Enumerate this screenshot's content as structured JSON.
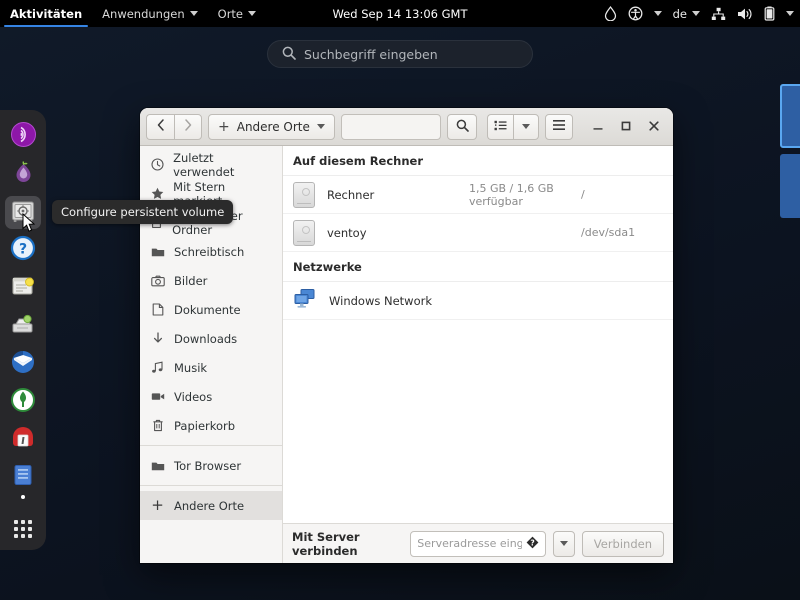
{
  "topbar": {
    "activities": "Aktivitäten",
    "applications": "Anwendungen",
    "places": "Orte",
    "clock": "Wed Sep 14  13:06 GMT",
    "keyboard_layout": "de",
    "icons": [
      "water-drop-icon",
      "accessibility-icon",
      "keyboard-layout-indicator",
      "network-wired-icon",
      "volume-icon",
      "battery-icon",
      "system-menu-caret-icon"
    ]
  },
  "overview": {
    "search_placeholder": "Suchbegriff eingeben",
    "search_icon": "search-icon",
    "workspaces": [
      {
        "label": "workspace-1",
        "active": true
      },
      {
        "label": "workspace-2",
        "active": false
      }
    ]
  },
  "dash": {
    "tooltip": "Configure persistent volume",
    "items": [
      {
        "name": "tor-connection",
        "icon": "tor-connection-icon",
        "active": false,
        "running": false
      },
      {
        "name": "tor-browser",
        "icon": "onion-icon",
        "active": false,
        "running": false
      },
      {
        "name": "configure-persistent-volume",
        "icon": "safe-icon",
        "active": true,
        "running": false
      },
      {
        "name": "tails-documentation",
        "icon": "help-circle-icon",
        "active": false,
        "running": false
      },
      {
        "name": "text-editor",
        "icon": "notes-icon",
        "active": false,
        "running": false
      },
      {
        "name": "gnome-screenshot",
        "icon": "utilities-icon",
        "active": false,
        "running": false
      },
      {
        "name": "thunderbird",
        "icon": "mail-icon",
        "active": false,
        "running": false
      },
      {
        "name": "keepassxc",
        "icon": "key-shield-icon",
        "active": false,
        "running": false
      },
      {
        "name": "tails-installer",
        "icon": "usb-installer-icon",
        "active": false,
        "running": false
      },
      {
        "name": "files",
        "icon": "files-icon",
        "active": false,
        "running": true
      },
      {
        "name": "show-applications",
        "icon": "apps-grid-icon",
        "active": false,
        "running": false
      }
    ]
  },
  "window": {
    "headerbar": {
      "back_icon": "chevron-left-icon",
      "forward_icon": "chevron-right-icon",
      "new_tab_icon": "plus-icon",
      "path_label": "Andere Orte",
      "path_caret_icon": "chevron-down-icon",
      "location_value": "",
      "search_icon": "search-icon",
      "view_list_icon": "view-list-icon",
      "view_caret_icon": "chevron-down-icon",
      "menu_icon": "hamburger-menu-icon",
      "minimize_icon": "minimize-icon",
      "maximize_icon": "maximize-icon",
      "close_icon": "close-icon"
    },
    "sidebar": {
      "items": [
        {
          "label": "Zuletzt verwendet",
          "icon": "clock-icon",
          "selected": false
        },
        {
          "label": "Mit Stern markiert",
          "icon": "star-icon",
          "selected": false
        },
        {
          "label": "Persönlicher Ordner",
          "icon": "home-icon",
          "selected": false
        },
        {
          "label": "Schreibtisch",
          "icon": "folder-icon",
          "selected": false
        },
        {
          "label": "Bilder",
          "icon": "camera-icon",
          "selected": false
        },
        {
          "label": "Dokumente",
          "icon": "document-icon",
          "selected": false
        },
        {
          "label": "Downloads",
          "icon": "download-arrow-icon",
          "selected": false
        },
        {
          "label": "Musik",
          "icon": "music-note-icon",
          "selected": false
        },
        {
          "label": "Videos",
          "icon": "video-camera-icon",
          "selected": false
        },
        {
          "label": "Papierkorb",
          "icon": "trash-icon",
          "selected": false
        }
      ],
      "bookmarks": [
        {
          "label": "Tor Browser",
          "icon": "folder-icon",
          "selected": false
        }
      ],
      "other_places": {
        "label": "Andere Orte",
        "icon": "plus-icon",
        "selected": true
      }
    },
    "content": {
      "section_local": "Auf diesem Rechner",
      "section_network": "Netzwerke",
      "volumes": [
        {
          "name": "Rechner",
          "icon": "hard-disk-icon",
          "free_space": "1,5 GB / 1,6 GB verfügbar",
          "mount": "/"
        },
        {
          "name": "ventoy",
          "icon": "hard-disk-icon",
          "free_space": "",
          "mount": "/dev/sda1"
        }
      ],
      "networks": [
        {
          "name": "Windows Network",
          "icon": "network-workgroup-icon"
        }
      ]
    },
    "connect_bar": {
      "label": "Mit Server verbinden",
      "address_placeholder": "Serveradresse eingeb...",
      "help_icon": "help-question-icon",
      "dropdown_icon": "chevron-down-icon",
      "connect_label": "Verbinden"
    }
  },
  "colors": {
    "accent": "#3584e4",
    "topbar_bg": "#000000",
    "desktop_bg": "#101828",
    "dash_bg": "#27272a",
    "window_bg": "#ffffff",
    "sidebar_bg": "#f6f5f4",
    "workspace_active_border": "#5aa7f0"
  }
}
